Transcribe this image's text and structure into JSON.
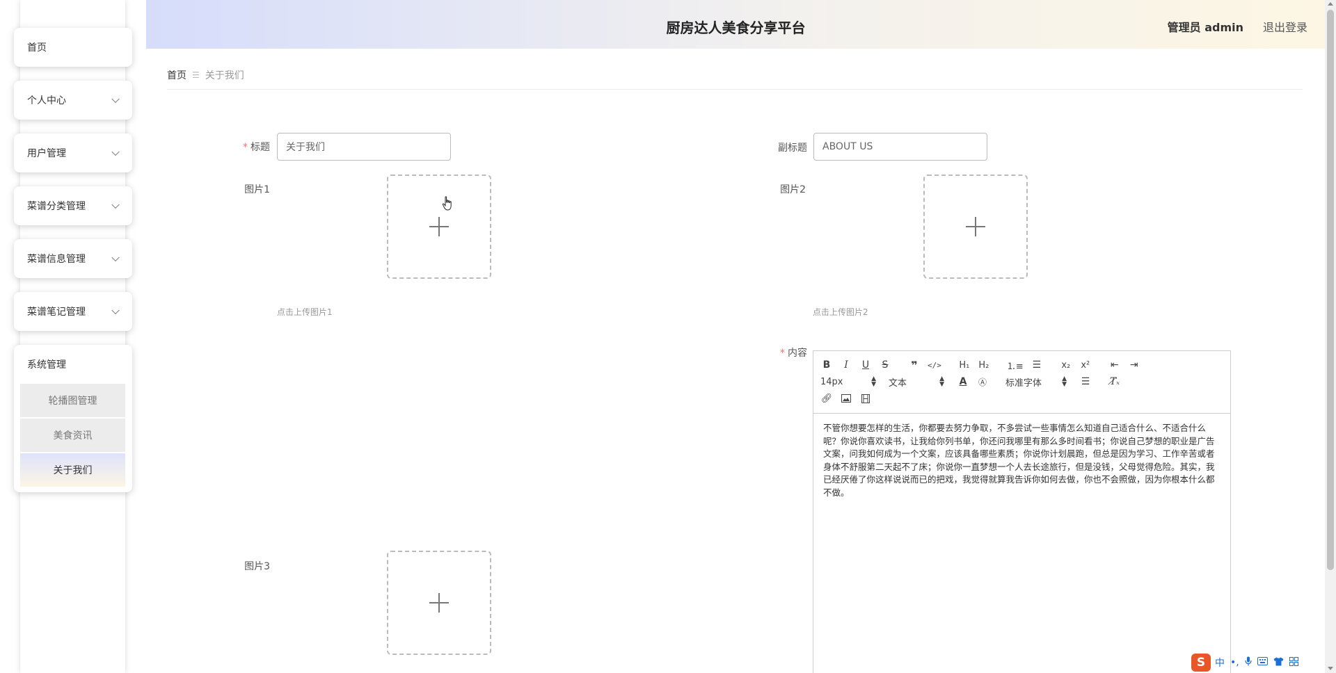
{
  "header": {
    "title": "厨房达人美食分享平台",
    "user": "管理员 admin",
    "logout": "退出登录"
  },
  "sidebar": {
    "items": [
      {
        "label": "首页"
      },
      {
        "label": "个人中心"
      },
      {
        "label": "用户管理"
      },
      {
        "label": "菜谱分类管理"
      },
      {
        "label": "菜谱信息管理"
      },
      {
        "label": "菜谱笔记管理"
      }
    ],
    "group": {
      "label": "系统管理",
      "children": [
        {
          "label": "轮播图管理"
        },
        {
          "label": "美食资讯"
        },
        {
          "label": "关于我们"
        }
      ]
    }
  },
  "breadcrumb": {
    "home": "首页",
    "current": "关于我们"
  },
  "form": {
    "title_label": "标题",
    "title_value": "关于我们",
    "subtitle_label": "副标题",
    "subtitle_value": "ABOUT US",
    "image1_label": "图片1",
    "image1_hint": "点击上传图片1",
    "image2_label": "图片2",
    "image2_hint": "点击上传图片2",
    "image3_label": "图片3",
    "content_label": "内容"
  },
  "editor": {
    "font_size": "14px",
    "block_type": "文本",
    "font_family": "标准字体",
    "content": "不管你想要怎样的生活，你都要去努力争取，不多尝试一些事情怎么知道自己适合什么、不适合什么呢？你说你喜欢读书，让我给你列书单，你还问我哪里有那么多时间看书；你说自己梦想的职业是广告文案，问我如何成为一个文案，应该具备哪些素质；你说你计划晨跑，但总是因为学习、工作辛苦或者身体不舒服第二天起不了床；你说你一直梦想一个人去长途旅行，但是没钱，父母觉得危险。其实，我已经厌倦了你这样说说而已的把戏，我觉得就算我告诉你如何去做，你也不会照做，因为你根本什么都不做。"
  },
  "ime": {
    "logo": "S",
    "lang": "中"
  }
}
